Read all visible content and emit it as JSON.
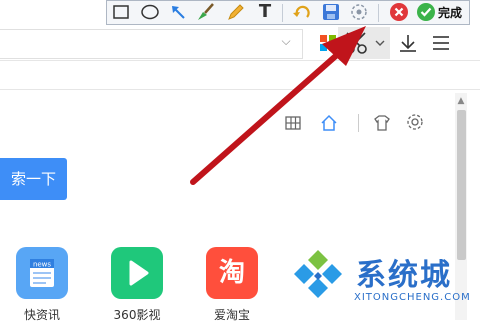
{
  "capture_toolbar": {
    "tools": [
      {
        "icon": "rectangle-icon"
      },
      {
        "icon": "ellipse-icon"
      },
      {
        "icon": "arrow-tool-icon"
      },
      {
        "icon": "brush-icon"
      },
      {
        "icon": "pencil-icon"
      },
      {
        "icon": "text-tool-icon",
        "glyph": "T"
      },
      {
        "icon": "undo-icon"
      },
      {
        "icon": "save-icon"
      },
      {
        "icon": "mosaic-icon"
      }
    ],
    "cancel_icon": "close-circle-icon",
    "done_label": "完成"
  },
  "browser_toolbar": {
    "icons": [
      "apps-icon",
      "scissors-icon",
      "chevron-down-icon",
      "download-icon",
      "menu-icon"
    ]
  },
  "page_tools": {
    "icons": [
      "grid-icon",
      "home-icon",
      "skin-icon",
      "settings-icon"
    ]
  },
  "search": {
    "button_label": "索一下"
  },
  "tiles": [
    {
      "label": "快资讯",
      "badge": "news",
      "color": "#58a6f5"
    },
    {
      "label": "360影视",
      "color": "#1fc87b"
    },
    {
      "label": "爱淘宝",
      "glyph": "淘",
      "color": "#ff4f3c"
    }
  ],
  "watermark": {
    "cn": "系统城",
    "en": "XITONGCHENG.COM"
  },
  "colors": {
    "accent": "#3e8ef7",
    "arrow": "#c0141b",
    "watermark": "#2a6fc9"
  }
}
